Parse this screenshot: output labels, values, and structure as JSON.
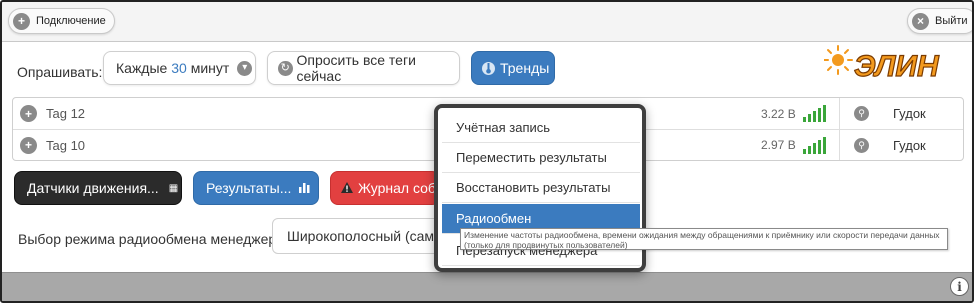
{
  "topbar": {
    "connect_label": "Подключение",
    "exit_label": "Выйти"
  },
  "poll": {
    "label": "Опрашивать:",
    "interval_prefix": "Каждые",
    "interval_value": "30",
    "interval_suffix": "минут",
    "poll_all_label": "Опросить все теги сейчас",
    "trends_label": "Тренды"
  },
  "logo_text": "ЭЛИН",
  "tags": [
    {
      "name": "Tag 12",
      "voltage": "3.22 В",
      "action": "Гудок"
    },
    {
      "name": "Tag 10",
      "voltage": "2.97 В",
      "action": "Гудок"
    }
  ],
  "action_buttons": {
    "motion_sensors": "Датчики движения...",
    "results": "Результаты...",
    "event_log": "Журнал собы"
  },
  "radio_mode": {
    "label": "Выбор режима радиообмена менеджера:",
    "selected": "Широкополосный (самый"
  },
  "menu": {
    "items": [
      "Учётная запись",
      "Переместить результаты",
      "Восстановить результаты",
      "Радиообмен",
      "Перезапуск менеджера"
    ],
    "active_index": 3,
    "tooltip": "Изменение частоты радиообмена, времени ожидания между обращениями к приёмнику или скорости передачи данных (только для продвинутых пользователей)"
  },
  "colors": {
    "accent_blue": "#3b7bbf",
    "danger_red": "#e24040",
    "dark_button": "#2b2b2b",
    "signal_green": "#3aa63a",
    "logo_orange": "#f39a1e"
  }
}
